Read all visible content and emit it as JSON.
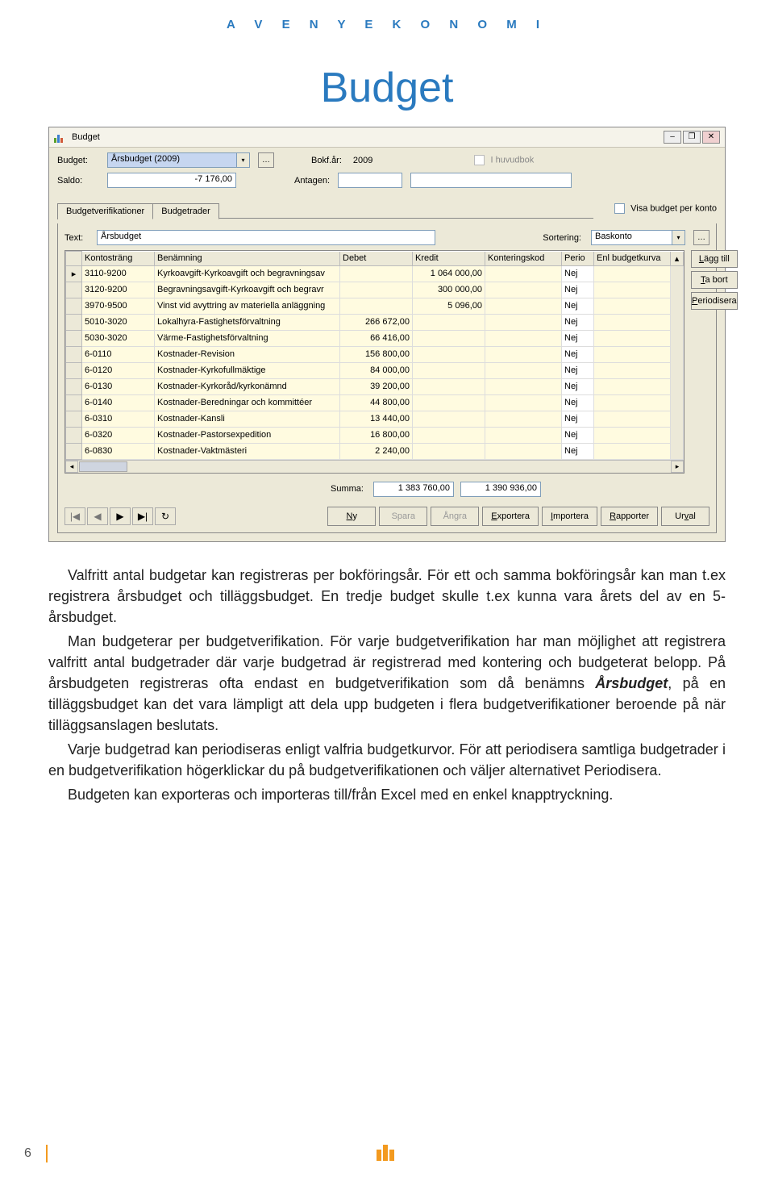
{
  "header": {
    "letters": "A V E N Y   E K O N O M I"
  },
  "title": "Budget",
  "window": {
    "title": "Budget",
    "controls": {
      "min": "–",
      "max": "❐",
      "close": "✕"
    }
  },
  "form": {
    "budget_label": "Budget:",
    "budget_value": "Årsbudget (2009)",
    "bokf_ar_label": "Bokf.år:",
    "bokf_ar_value": "2009",
    "i_huvudbok_label": "I huvudbok",
    "saldo_label": "Saldo:",
    "saldo_value": "-7 176,00",
    "antagen_label": "Antagen:",
    "antagen_value": "",
    "visa_budget_label": "Visa budget per konto"
  },
  "tabs": {
    "tab1": "Budgetverifikationer",
    "tab2": "Budgetrader"
  },
  "tabbody": {
    "text_label": "Text:",
    "text_value": "Årsbudget",
    "sortering_label": "Sortering:",
    "sortering_value": "Baskonto"
  },
  "grid": {
    "headers": {
      "kontostrang": "Kontosträng",
      "benamning": "Benämning",
      "debet": "Debet",
      "kredit": "Kredit",
      "konteringskod": "Konteringskod",
      "perio": "Perio",
      "enl": "Enl budgetkurva"
    },
    "rows": [
      {
        "k": "3110-9200",
        "b": "Kyrkoavgift-Kyrkoavgift och begravningsav",
        "d": "",
        "c": "1 064 000,00",
        "kod": "",
        "p": "Nej",
        "e": ""
      },
      {
        "k": "3120-9200",
        "b": "Begravningsavgift-Kyrkoavgift och begravr",
        "d": "",
        "c": "300 000,00",
        "kod": "",
        "p": "Nej",
        "e": ""
      },
      {
        "k": "3970-9500",
        "b": "Vinst vid avyttring av materiella anläggning",
        "d": "",
        "c": "5 096,00",
        "kod": "",
        "p": "Nej",
        "e": ""
      },
      {
        "k": "5010-3020",
        "b": "Lokalhyra-Fastighetsförvaltning",
        "d": "266 672,00",
        "c": "",
        "kod": "",
        "p": "Nej",
        "e": ""
      },
      {
        "k": "5030-3020",
        "b": "Värme-Fastighetsförvaltning",
        "d": "66 416,00",
        "c": "",
        "kod": "",
        "p": "Nej",
        "e": ""
      },
      {
        "k": "6-0110",
        "b": "Kostnader-Revision",
        "d": "156 800,00",
        "c": "",
        "kod": "",
        "p": "Nej",
        "e": ""
      },
      {
        "k": "6-0120",
        "b": "Kostnader-Kyrkofullmäktige",
        "d": "84 000,00",
        "c": "",
        "kod": "",
        "p": "Nej",
        "e": ""
      },
      {
        "k": "6-0130",
        "b": "Kostnader-Kyrkoråd/kyrkonämnd",
        "d": "39 200,00",
        "c": "",
        "kod": "",
        "p": "Nej",
        "e": ""
      },
      {
        "k": "6-0140",
        "b": "Kostnader-Beredningar och kommittéer",
        "d": "44 800,00",
        "c": "",
        "kod": "",
        "p": "Nej",
        "e": ""
      },
      {
        "k": "6-0310",
        "b": "Kostnader-Kansli",
        "d": "13 440,00",
        "c": "",
        "kod": "",
        "p": "Nej",
        "e": ""
      },
      {
        "k": "6-0320",
        "b": "Kostnader-Pastorsexpedition",
        "d": "16 800,00",
        "c": "",
        "kod": "",
        "p": "Nej",
        "e": ""
      },
      {
        "k": "6-0830",
        "b": "Kostnader-Vaktmästeri",
        "d": "2 240,00",
        "c": "",
        "kod": "",
        "p": "Nej",
        "e": ""
      }
    ]
  },
  "side": {
    "lagg_till": "Lägg till",
    "ta_bort": "Ta bort",
    "periodisera": "Periodisera"
  },
  "summa": {
    "label": "Summa:",
    "debet": "1 383 760,00",
    "kredit": "1 390 936,00"
  },
  "nav": {
    "first": "|◀",
    "prev": "◀",
    "next": "▶",
    "last": "▶|",
    "refresh": "↻"
  },
  "bottom": {
    "ny": "Ny",
    "spara": "Spara",
    "angra": "Ångra",
    "exportera": "Exportera",
    "importera": "Importera",
    "rapporter": "Rapporter",
    "urval": "Urval"
  },
  "body": {
    "p1a": "Valfritt antal budgetar kan registreras per bokföringsår. För ett och samma bokföringsår kan man t.ex registrera årsbudget och tilläggsbudget. En tredje budget skulle t.ex kunna vara årets del av en 5-årsbudget.",
    "p2a": "Man budgeterar per budgetverifikation. För varje budgetverifikation har man möjlighet att registrera valfritt antal budgetrader där varje budgetrad är registrerad med kontering och budgeterat belopp. På årsbudgeten registreras ofta endast en budgetverifikation som då benämns ",
    "p2kw": "Årsbudget",
    "p2b": ", på en tilläggsbudget kan det vara lämpligt att dela upp budgeten i flera budgetverifikationer beroende på när tilläggsanslagen beslutats.",
    "p3": "Varje budgetrad kan periodiseras enligt valfria budgetkurvor. För att periodisera samtliga budgetrader i en budgetverifikation högerklickar du på budgetverifikationen och väljer alternativet Periodisera.",
    "p4": "Budgeten kan exporteras och importeras till/från Excel med en enkel knapptryckning."
  },
  "footer": {
    "page": "6"
  }
}
